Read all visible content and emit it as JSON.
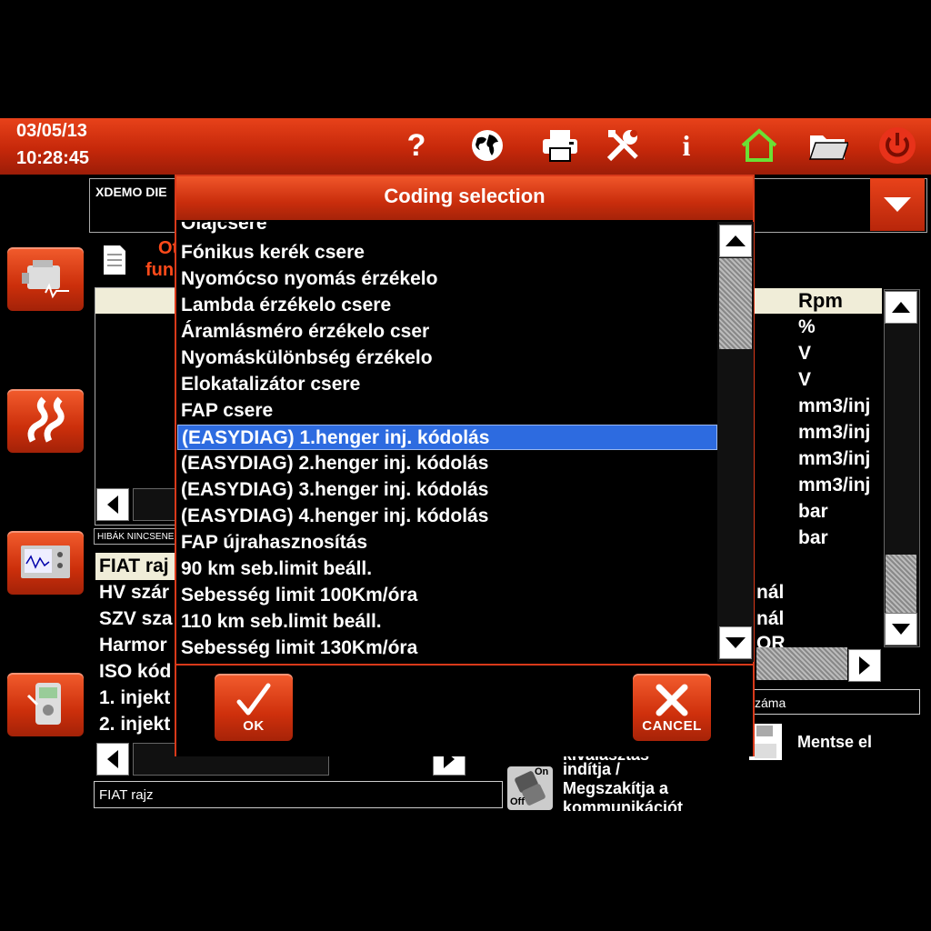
{
  "header": {
    "date": "03/05/13",
    "time": "10:28:45",
    "icons": [
      "help-icon",
      "globe-icon",
      "print-icon",
      "tools-icon",
      "info-icon",
      "home-icon",
      "folder-icon",
      "power-icon"
    ]
  },
  "background": {
    "vehicle_box": "XDEMO DIE",
    "func_line1": "Ot",
    "func_line2": "fun",
    "errors_strip": "HIBÁK NINCSENEK",
    "params_header": "Rpm",
    "units": [
      "%",
      "V",
      "V",
      "mm3/inj",
      "mm3/inj",
      "mm3/inj",
      "mm3/inj",
      "bar",
      "bar"
    ],
    "info_rows": [
      "FIAT raj",
      "HV szár",
      "SZV sza",
      "Harmor",
      "ISO kód",
      "1. injekt",
      "2. injekt"
    ],
    "right_fragments": [
      "nál",
      "nál",
      "OR"
    ],
    "bottom_field": "FIAT rajz",
    "small_field_right": "záma",
    "save_label": "Mentse el",
    "comm_text_partial": "kiválasztás",
    "comm_text_1": "indítja /",
    "comm_text_2": "Megszakítja a",
    "comm_text_3": "kommunikációt",
    "onoff_on": "On",
    "onoff_off": "Off"
  },
  "dialog": {
    "title": "Coding selection",
    "items": [
      "Olajcsere",
      "Fónikus kerék csere",
      "Nyomócso nyomás érzékelo",
      "Lambda érzékelo csere",
      "Áramlásméro érzékelo cser",
      "Nyomáskülönbség érzékelo",
      "Elokatalizátor csere",
      "FAP csere",
      "(EASYDIAG) 1.henger inj. kódolás",
      "(EASYDIAG) 2.henger inj. kódolás",
      "(EASYDIAG) 3.henger inj. kódolás",
      "(EASYDIAG) 4.henger inj. kódolás",
      "FAP újrahasznosítás",
      "90 km seb.limit beáll.",
      "Sebesség limit 100Km/óra",
      "110 km seb.limit beáll.",
      "Sebesség limit 130Km/óra"
    ],
    "selected_index": 8,
    "ok_label": "OK",
    "cancel_label": "CANCEL"
  },
  "colors": {
    "accent_red": "#d8391a",
    "selection_blue": "#2d6be0",
    "home_green": "#6be034"
  }
}
